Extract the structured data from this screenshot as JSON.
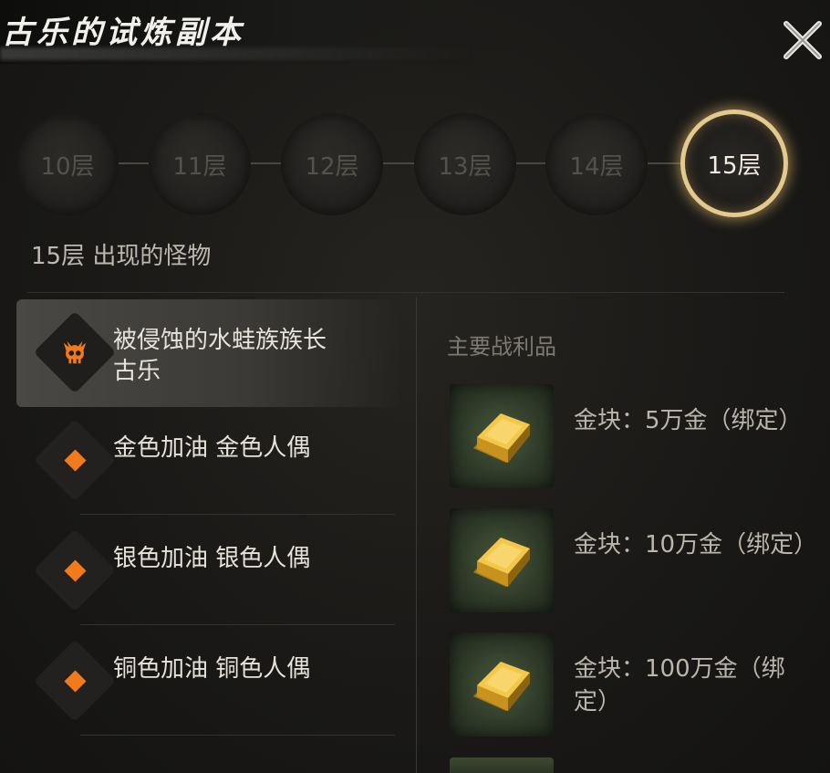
{
  "header": {
    "title": "古乐的试炼副本"
  },
  "floors": [
    {
      "label": "10层",
      "active": false
    },
    {
      "label": "11层",
      "active": false
    },
    {
      "label": "12层",
      "active": false
    },
    {
      "label": "13层",
      "active": false
    },
    {
      "label": "14层",
      "active": false
    },
    {
      "label": "15层",
      "active": true
    }
  ],
  "monsters": {
    "section_title": "15层 出现的怪物",
    "items": [
      {
        "name": "被侵蚀的水蛙族族长 古乐",
        "icon": "skull-icon",
        "boss": true
      },
      {
        "name": "金色加油 金色人偶",
        "icon": "diamond-icon",
        "boss": false
      },
      {
        "name": "银色加油 银色人偶",
        "icon": "diamond-icon",
        "boss": false
      },
      {
        "name": "铜色加油 铜色人偶",
        "icon": "diamond-icon",
        "boss": false
      }
    ]
  },
  "loot": {
    "title": "主要战利品",
    "items": [
      {
        "text": "金块：5万金（绑定）",
        "icon": "gold-bar-icon"
      },
      {
        "text": "金块：10万金（绑定）",
        "icon": "gold-bar-icon"
      },
      {
        "text": "金块：100万金（绑定）",
        "icon": "gold-bar-icon"
      }
    ]
  },
  "colors": {
    "accent_gold": "#e4c98e",
    "monster_marker": "#f07a1c"
  }
}
